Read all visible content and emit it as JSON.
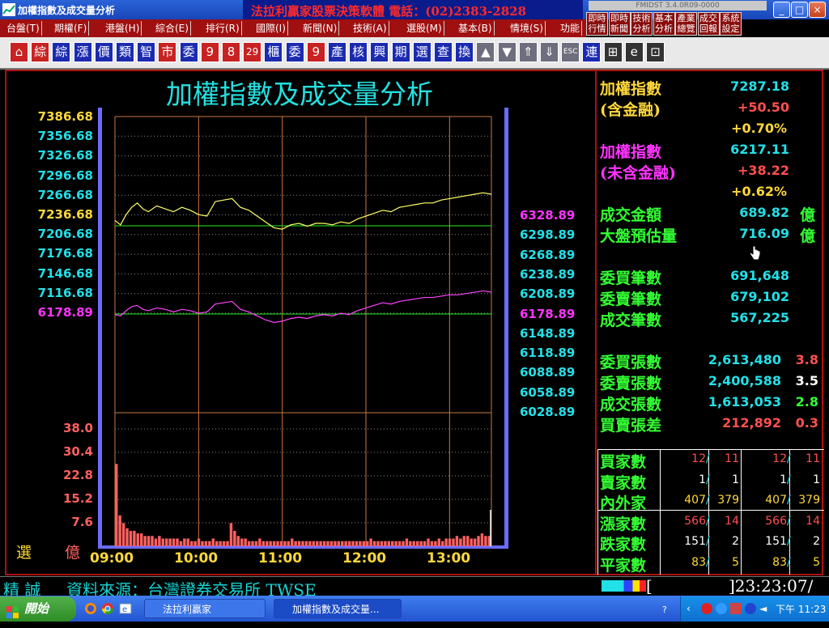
{
  "window": {
    "title": "加權指數及成交量分析",
    "banner": "法拉利贏家股票決策軟體 電話：(02)2383-2828",
    "version": "FMIDST 3.4.0R09-0000",
    "minimize": "_",
    "maximize": "□",
    "close": "×"
  },
  "menu": [
    {
      "label": "台盤(T)"
    },
    {
      "label": "期權(F)"
    },
    {
      "label": "港盤(H)"
    },
    {
      "label": "綜合(E)"
    },
    {
      "label": "排行(R)"
    },
    {
      "label": "國際(I)"
    },
    {
      "label": "新聞(N)"
    },
    {
      "label": "技術(A)"
    },
    {
      "label": "選股(M)"
    },
    {
      "label": "基本(B)"
    },
    {
      "label": "情境(S)"
    },
    {
      "label": "功能"
    }
  ],
  "quick_buttons": [
    {
      "label": "即時行情"
    },
    {
      "label": "即時新聞"
    },
    {
      "label": "技術分析"
    },
    {
      "label": "基本分析"
    },
    {
      "label": "產業總覽"
    },
    {
      "label": "成交回報"
    },
    {
      "label": "系統設定"
    }
  ],
  "toolbar": [
    {
      "label": "⌂",
      "icon": "home-icon",
      "style": "red"
    },
    {
      "label": "綜",
      "style": "red"
    },
    {
      "label": "綜",
      "style": "blue"
    },
    {
      "label": "漲",
      "style": "blue"
    },
    {
      "label": "價",
      "style": "blue"
    },
    {
      "label": "類",
      "style": "blue"
    },
    {
      "label": "智",
      "style": "blue"
    },
    {
      "label": "市",
      "style": "red"
    },
    {
      "label": "委",
      "style": "blue"
    },
    {
      "label": "9",
      "style": "red"
    },
    {
      "label": "8",
      "style": "red"
    },
    {
      "label": "29",
      "style": "red"
    },
    {
      "label": "櫃",
      "style": "blue"
    },
    {
      "label": "委",
      "style": "blue"
    },
    {
      "label": "9",
      "style": "red"
    },
    {
      "label": "產",
      "style": "blue"
    },
    {
      "label": "核",
      "style": "blue"
    },
    {
      "label": "興",
      "style": "blue"
    },
    {
      "label": "期",
      "style": "blue"
    },
    {
      "label": "選",
      "style": "blue"
    },
    {
      "label": "查",
      "style": "blue"
    },
    {
      "label": "換",
      "style": "blue"
    },
    {
      "label": "▲",
      "icon": "arrow-up-icon",
      "style": "grey"
    },
    {
      "label": "▼",
      "icon": "arrow-down-icon",
      "style": "grey"
    },
    {
      "label": "⇑",
      "icon": "double-up-icon",
      "style": "grey"
    },
    {
      "label": "⇓",
      "icon": "double-down-icon",
      "style": "grey"
    },
    {
      "label": "ESC",
      "icon": "escape-icon",
      "style": "grey"
    },
    {
      "label": "連",
      "style": "blue"
    },
    {
      "label": "⊞",
      "icon": "window-icon",
      "style": "dark"
    },
    {
      "label": "e",
      "icon": "browser-icon",
      "style": "dark"
    },
    {
      "label": "⊡",
      "icon": "lock-icon",
      "style": "dark"
    }
  ],
  "chart_data": {
    "type": "line",
    "title": "加權指數及成交量分析",
    "x_labels": [
      "09:00",
      "10:00",
      "11:00",
      "12:00",
      "13:00"
    ],
    "left_y_ticks": [
      {
        "text": "7386.68",
        "color": "#ffd83a"
      },
      {
        "text": "7356.68",
        "color": "#22e0e8"
      },
      {
        "text": "7326.68",
        "color": "#22e0e8"
      },
      {
        "text": "7296.68",
        "color": "#22e0e8"
      },
      {
        "text": "7266.68",
        "color": "#22e0e8"
      },
      {
        "text": "7236.68",
        "color": "#ffd83a"
      },
      {
        "text": "7206.68",
        "color": "#22e0e8"
      },
      {
        "text": "7176.68",
        "color": "#22e0e8"
      },
      {
        "text": "7146.68",
        "color": "#22e0e8"
      },
      {
        "text": "7116.68",
        "color": "#22e0e8"
      },
      {
        "text": "6178.89",
        "color": "#ff33ff"
      }
    ],
    "right_y_ticks": [
      {
        "text": "6328.89",
        "color": "#ff33ff"
      },
      {
        "text": "6298.89",
        "color": "#22e0e8"
      },
      {
        "text": "6268.89",
        "color": "#22e0e8"
      },
      {
        "text": "6238.89",
        "color": "#22e0e8"
      },
      {
        "text": "6208.89",
        "color": "#22e0e8"
      },
      {
        "text": "6178.89",
        "color": "#ff33ff"
      },
      {
        "text": "6148.89",
        "color": "#22e0e8"
      },
      {
        "text": "6118.89",
        "color": "#22e0e8"
      },
      {
        "text": "6088.89",
        "color": "#22e0e8"
      },
      {
        "text": "6058.89",
        "color": "#22e0e8"
      },
      {
        "text": "6028.89",
        "color": "#22e0e8"
      }
    ],
    "volume_ticks": [
      "38.0",
      "30.4",
      "22.8",
      "15.2",
      "7.6"
    ],
    "volume_unit": "億",
    "volume_label": "選",
    "ylim_index": [
      7116.68,
      7386.68
    ],
    "ylim_index_ex": [
      6028.89,
      6328.89
    ],
    "ylim_volume": [
      0,
      45.6
    ],
    "reference": {
      "index": 7236.68,
      "index_ex": 6178.89
    },
    "colors": {
      "index": "#ffff66",
      "index_ex": "#ff44ff",
      "reference": "#22ee22",
      "volume": "#ff6060",
      "grid": "#c87840"
    },
    "series": [
      {
        "name": "加權指數(含金融)",
        "x": [
          0,
          4,
          8,
          12,
          16,
          20,
          24,
          30,
          36,
          42,
          48,
          54,
          60,
          66,
          72,
          78,
          84,
          90,
          96,
          102,
          108,
          114,
          120,
          126,
          132,
          138,
          144,
          150,
          156,
          162,
          168,
          174,
          180,
          186,
          192,
          198,
          204,
          210,
          216,
          222,
          228,
          234,
          240,
          246,
          252,
          258,
          264,
          270
        ],
        "y": [
          7244,
          7238,
          7252,
          7262,
          7268,
          7260,
          7256,
          7264,
          7260,
          7256,
          7262,
          7258,
          7252,
          7250,
          7270,
          7272,
          7274,
          7262,
          7258,
          7250,
          7242,
          7234,
          7232,
          7238,
          7240,
          7236,
          7240,
          7240,
          7238,
          7242,
          7240,
          7246,
          7250,
          7254,
          7258,
          7256,
          7262,
          7264,
          7266,
          7268,
          7268,
          7272,
          7274,
          7276,
          7278,
          7280,
          7282,
          7280
        ]
      },
      {
        "name": "加權指數(未含金融)",
        "x": [
          0,
          4,
          8,
          12,
          16,
          20,
          24,
          30,
          36,
          42,
          48,
          54,
          60,
          66,
          72,
          78,
          84,
          90,
          96,
          102,
          108,
          114,
          120,
          126,
          132,
          138,
          144,
          150,
          156,
          162,
          168,
          174,
          180,
          186,
          192,
          198,
          204,
          210,
          216,
          222,
          228,
          234,
          240,
          246,
          252,
          258,
          264,
          270
        ],
        "y": [
          6178,
          6176,
          6184,
          6190,
          6192,
          6186,
          6184,
          6188,
          6186,
          6182,
          6186,
          6184,
          6180,
          6182,
          6194,
          6196,
          6198,
          6186,
          6182,
          6176,
          6170,
          6166,
          6168,
          6172,
          6174,
          6172,
          6176,
          6178,
          6176,
          6180,
          6178,
          6184,
          6188,
          6192,
          6196,
          6194,
          6198,
          6200,
          6202,
          6204,
          6204,
          6206,
          6208,
          6208,
          6210,
          6212,
          6214,
          6212
        ]
      },
      {
        "name": "成交量",
        "type": "bar",
        "values": [
          32,
          12,
          9,
          7,
          6,
          6,
          5,
          5,
          4,
          4,
          4,
          3,
          4,
          3,
          3,
          3,
          3,
          3,
          2,
          3,
          3,
          2,
          2,
          3,
          2,
          2,
          2,
          3,
          2,
          2,
          2,
          2,
          9,
          6,
          4,
          3,
          3,
          2,
          2,
          2,
          3,
          2,
          2,
          2,
          2,
          2,
          2,
          2,
          2,
          3,
          2,
          2,
          2,
          2,
          2,
          2,
          2,
          2,
          2,
          2,
          2,
          2,
          2,
          2,
          2,
          2,
          2,
          2,
          2,
          2,
          2,
          3,
          2,
          2,
          2,
          2,
          2,
          2,
          2,
          2,
          2,
          3,
          2,
          2,
          2,
          2,
          2,
          3,
          2,
          2,
          3,
          2,
          3,
          3,
          3,
          4,
          3,
          4,
          4,
          3,
          3,
          4,
          5,
          4,
          4
        ]
      }
    ]
  },
  "panel": {
    "index_incl": {
      "label": "加權指數",
      "sub": "(含金融)",
      "value": "7287.18",
      "change": "+50.50",
      "pct": "+0.70%"
    },
    "index_excl": {
      "label": "加權指數",
      "sub": "(未含金融)",
      "value": "6217.11",
      "change": "+38.22",
      "pct": "+0.62%"
    },
    "turnover": {
      "label": "成交金額",
      "value": "689.82",
      "unit": "億"
    },
    "estimate": {
      "label": "大盤預估量",
      "value": "716.09",
      "unit": "億"
    },
    "counts": [
      {
        "label": "委買筆數",
        "value": "691,648"
      },
      {
        "label": "委賣筆數",
        "value": "679,102"
      },
      {
        "label": "成交筆數",
        "value": "567,225"
      }
    ],
    "sheets": [
      {
        "label": "委買張數",
        "value": "2,613,480",
        "ratio": "3.8",
        "ratio_color": "#ff5050"
      },
      {
        "label": "委賣張數",
        "value": "2,400,588",
        "ratio": "3.5",
        "ratio_color": "#ffffff"
      },
      {
        "label": "成交張數",
        "value": "1,613,053",
        "ratio": "2.8",
        "ratio_color": "#33ff33"
      },
      {
        "label": "買賣張差",
        "value": "212,892",
        "ratio": "0.3",
        "ratio_color": "#ff5050"
      }
    ],
    "breadth": [
      {
        "label": "買家數",
        "a": "12",
        "b": "11",
        "c": "12",
        "d": "11",
        "color": "#ff5050"
      },
      {
        "label": "賣家數",
        "a": "1",
        "b": "1",
        "c": "1",
        "d": "1",
        "color": "#ffffff"
      },
      {
        "label": "內外家",
        "a": "407",
        "b": "379",
        "c": "407",
        "d": "379",
        "color": "#ffd83a"
      },
      {
        "label": "漲家數",
        "a": "566",
        "b": "14",
        "c": "566",
        "d": "14",
        "color": "#ff5050"
      },
      {
        "label": "跌家數",
        "a": "151",
        "b": "2",
        "c": "151",
        "d": "2",
        "color": "#ffffff"
      },
      {
        "label": "平家數",
        "a": "83",
        "b": "5",
        "c": "83",
        "d": "5",
        "color": "#ffd83a"
      }
    ]
  },
  "status": {
    "left": "精 誠",
    "source": "資料來源：台灣證券交易所 TWSE",
    "bracket": "[",
    "time": "]23:23:07/"
  },
  "taskbar": {
    "start": "開始",
    "tasks": [
      {
        "label": "法拉利贏家"
      },
      {
        "label": "加權指數及成交量..."
      }
    ],
    "clock": "下午 11:23"
  }
}
